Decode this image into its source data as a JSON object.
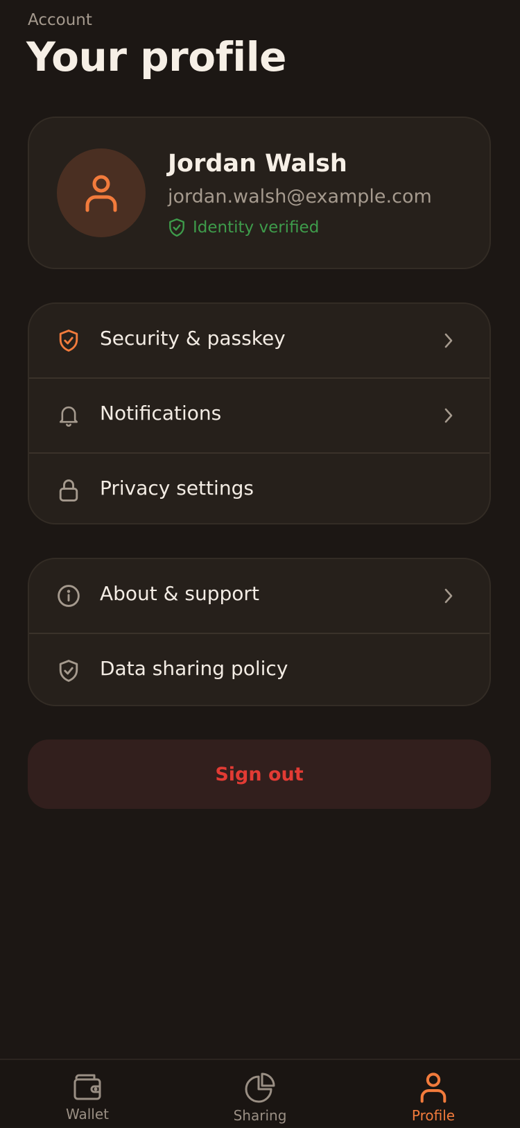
{
  "header": {
    "overline": "Account",
    "title": "Your profile"
  },
  "profile": {
    "name": "Jordan Walsh",
    "email": "jordan.walsh@example.com",
    "verified_label": "Identity verified",
    "avatar_icon": "user-icon"
  },
  "menu_primary": [
    {
      "label": "Security & passkey",
      "icon": "shield-check-icon",
      "chevron": true
    },
    {
      "label": "Notifications",
      "icon": "bell-icon",
      "chevron": true
    },
    {
      "label": "Privacy settings",
      "icon": "lock-icon",
      "chevron": false
    }
  ],
  "menu_secondary": [
    {
      "label": "About & support",
      "icon": "info-icon",
      "chevron": true
    },
    {
      "label": "Data sharing policy",
      "icon": "shield-check-icon",
      "chevron": false
    }
  ],
  "signout_label": "Sign out",
  "tabs": [
    {
      "label": "Wallet",
      "icon": "wallet-icon",
      "active": false
    },
    {
      "label": "Sharing",
      "icon": "pie-chart-icon",
      "active": false
    },
    {
      "label": "Profile",
      "icon": "user-icon",
      "active": true
    }
  ],
  "colors": {
    "background": "#1c1714",
    "card": "#26201b",
    "accent": "#f27b3c",
    "verified": "#3e9c4b",
    "danger": "#e23b34"
  }
}
